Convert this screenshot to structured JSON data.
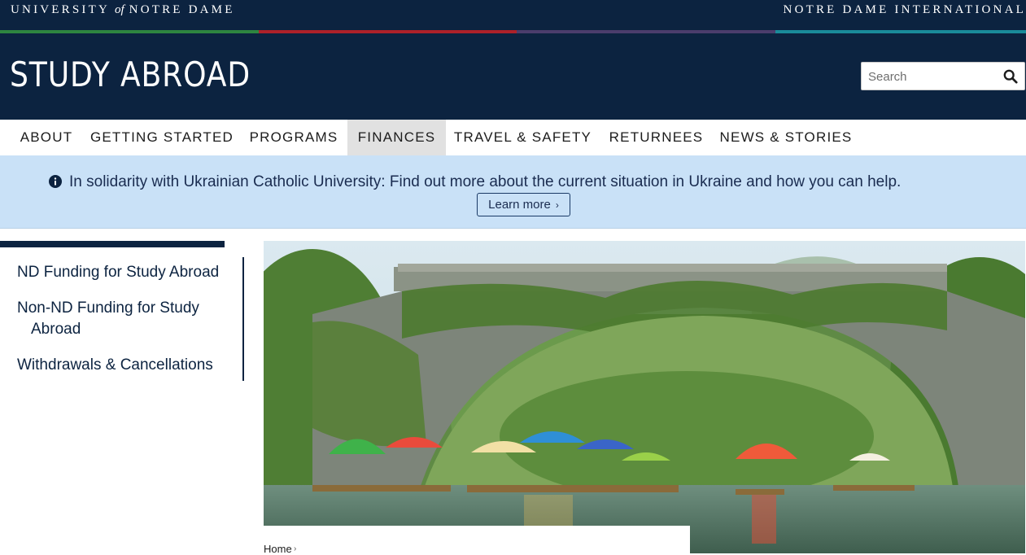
{
  "brand": {
    "university_pre": "UNIVERSITY",
    "university_of": "of",
    "university_post": "NOTRE DAME",
    "unit": "NOTRE DAME INTERNATIONAL",
    "stripe_colors": [
      "#2e8540",
      "#ae2129",
      "#4b3d6c",
      "#1a8b9a"
    ]
  },
  "header": {
    "title": "STUDY ABROAD",
    "search_placeholder": "Search",
    "search_icon": "search-icon"
  },
  "nav": {
    "items": [
      {
        "label": "ABOUT"
      },
      {
        "label": "GETTING STARTED"
      },
      {
        "label": "PROGRAMS"
      },
      {
        "label": "FINANCES",
        "active": true
      },
      {
        "label": "TRAVEL & SAFETY"
      },
      {
        "label": "RETURNEES"
      },
      {
        "label": "NEWS & STORIES"
      }
    ]
  },
  "alert": {
    "icon": "info-circle-icon",
    "text": "In solidarity with Ukrainian Catholic University: Find out more about the current situation in Ukraine and how you can help.",
    "button_label": "Learn more",
    "button_chevron": "›"
  },
  "sidebar": {
    "links": [
      {
        "line1": "ND Funding for Study Abroad",
        "line2": ""
      },
      {
        "line1": "Non-ND Funding for Study",
        "line2": "Abroad"
      },
      {
        "line1": "Withdrawals & Cancellations",
        "line2": ""
      }
    ]
  },
  "hero": {
    "alt": "Stone arch bridge over a river with bamboo rafts and colorful umbrellas"
  },
  "breadcrumb": {
    "home": "Home",
    "separator": "›"
  },
  "colors": {
    "navy": "#0c2340",
    "alert_bg": "#c9e1f7",
    "active_nav_bg": "#e1e1e1"
  }
}
